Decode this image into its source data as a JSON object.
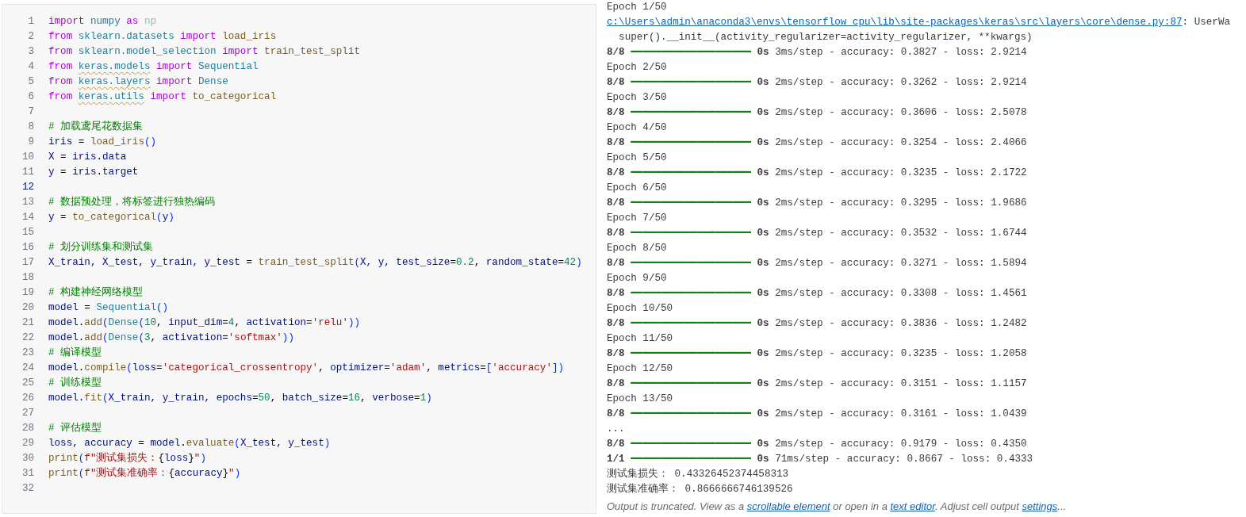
{
  "code_cell": {
    "lines": [
      {
        "n": "1",
        "active": false,
        "tokens": [
          {
            "kind": "kw",
            "text": "import"
          },
          {
            "kind": "mod",
            "text": " numpy"
          },
          {
            "kind": "kw",
            "text": " as"
          },
          {
            "kind": "dim",
            "text": " np"
          }
        ]
      },
      {
        "n": "2",
        "active": false,
        "tokens": [
          {
            "kind": "kw",
            "text": "from"
          },
          {
            "kind": "mod",
            "text": " sklearn.datasets"
          },
          {
            "kind": "kw",
            "text": " import"
          },
          {
            "kind": "fn",
            "text": " load_iris"
          }
        ]
      },
      {
        "n": "3",
        "active": false,
        "tokens": [
          {
            "kind": "kw",
            "text": "from"
          },
          {
            "kind": "mod",
            "text": " sklearn.model_selection"
          },
          {
            "kind": "kw",
            "text": " import"
          },
          {
            "kind": "fn",
            "text": " train_test_split"
          }
        ]
      },
      {
        "n": "4",
        "active": false,
        "tokens": [
          {
            "kind": "kw",
            "text": "from "
          },
          {
            "kind": "warn",
            "text": "keras.models"
          },
          {
            "kind": "kw",
            "text": " import"
          },
          {
            "kind": "mod",
            "text": " Sequential"
          }
        ]
      },
      {
        "n": "5",
        "active": false,
        "tokens": [
          {
            "kind": "kw",
            "text": "from "
          },
          {
            "kind": "warn",
            "text": "keras.layers"
          },
          {
            "kind": "kw",
            "text": " import"
          },
          {
            "kind": "mod",
            "text": " Dense"
          }
        ]
      },
      {
        "n": "6",
        "active": false,
        "tokens": [
          {
            "kind": "kw",
            "text": "from "
          },
          {
            "kind": "warn",
            "text": "keras.utils"
          },
          {
            "kind": "kw",
            "text": " import"
          },
          {
            "kind": "fn",
            "text": " to_categorical"
          }
        ]
      },
      {
        "n": "7",
        "active": false
      },
      {
        "n": "8",
        "active": false,
        "tokens": [
          {
            "kind": "com",
            "text": "# 加载鸢尾花数据集"
          }
        ]
      },
      {
        "n": "9",
        "active": false,
        "tokens": [
          {
            "kind": "var",
            "text": "iris"
          },
          {
            "kind": "p",
            "text": " = "
          },
          {
            "kind": "fn",
            "text": "load_iris"
          },
          {
            "kind": "br",
            "text": "()"
          }
        ]
      },
      {
        "n": "10",
        "active": false,
        "tokens": [
          {
            "kind": "var",
            "text": "X"
          },
          {
            "kind": "p",
            "text": " = "
          },
          {
            "kind": "var",
            "text": "iris"
          },
          {
            "kind": "p",
            "text": "."
          },
          {
            "kind": "var",
            "text": "data"
          }
        ]
      },
      {
        "n": "11",
        "active": false,
        "tokens": [
          {
            "kind": "var",
            "text": "y"
          },
          {
            "kind": "p",
            "text": " = "
          },
          {
            "kind": "var",
            "text": "iris"
          },
          {
            "kind": "p",
            "text": "."
          },
          {
            "kind": "var",
            "text": "target"
          }
        ]
      },
      {
        "n": "12",
        "active": true
      },
      {
        "n": "13",
        "active": false,
        "tokens": [
          {
            "kind": "com",
            "text": "# 数据预处理，将标签进行独热编码"
          }
        ]
      },
      {
        "n": "14",
        "active": false,
        "tokens": [
          {
            "kind": "var",
            "text": "y"
          },
          {
            "kind": "p",
            "text": " = "
          },
          {
            "kind": "fn",
            "text": "to_categorical"
          },
          {
            "kind": "br",
            "text": "("
          },
          {
            "kind": "var",
            "text": "y"
          },
          {
            "kind": "br",
            "text": ")"
          }
        ]
      },
      {
        "n": "15",
        "active": false
      },
      {
        "n": "16",
        "active": false,
        "tokens": [
          {
            "kind": "com",
            "text": "# 划分训练集和测试集"
          }
        ]
      },
      {
        "n": "17",
        "active": false,
        "tokens": [
          {
            "kind": "var",
            "text": "X_train, X_test, y_train, y_test"
          },
          {
            "kind": "p",
            "text": " = "
          },
          {
            "kind": "fn",
            "text": "train_test_split"
          },
          {
            "kind": "br",
            "text": "("
          },
          {
            "kind": "var",
            "text": "X, y, test_size"
          },
          {
            "kind": "p",
            "text": "="
          },
          {
            "kind": "num",
            "text": "0.2"
          },
          {
            "kind": "p",
            "text": ", "
          },
          {
            "kind": "var",
            "text": "random_state"
          },
          {
            "kind": "p",
            "text": "="
          },
          {
            "kind": "num",
            "text": "42"
          },
          {
            "kind": "br",
            "text": ")"
          }
        ]
      },
      {
        "n": "18",
        "active": false
      },
      {
        "n": "19",
        "active": false,
        "tokens": [
          {
            "kind": "com",
            "text": "# 构建神经网络模型"
          }
        ]
      },
      {
        "n": "20",
        "active": false,
        "tokens": [
          {
            "kind": "var",
            "text": "model"
          },
          {
            "kind": "p",
            "text": " = "
          },
          {
            "kind": "mod",
            "text": "Sequential"
          },
          {
            "kind": "br",
            "text": "()"
          }
        ]
      },
      {
        "n": "21",
        "active": false,
        "tokens": [
          {
            "kind": "var",
            "text": "model"
          },
          {
            "kind": "p",
            "text": "."
          },
          {
            "kind": "fn",
            "text": "add"
          },
          {
            "kind": "br",
            "text": "("
          },
          {
            "kind": "mod",
            "text": "Dense"
          },
          {
            "kind": "br",
            "text": "("
          },
          {
            "kind": "num",
            "text": "10"
          },
          {
            "kind": "p",
            "text": ", "
          },
          {
            "kind": "var",
            "text": "input_dim"
          },
          {
            "kind": "p",
            "text": "="
          },
          {
            "kind": "num",
            "text": "4"
          },
          {
            "kind": "p",
            "text": ", "
          },
          {
            "kind": "var",
            "text": "activation"
          },
          {
            "kind": "p",
            "text": "="
          },
          {
            "kind": "str",
            "text": "'relu'"
          },
          {
            "kind": "br",
            "text": "))"
          }
        ]
      },
      {
        "n": "22",
        "active": false,
        "tokens": [
          {
            "kind": "var",
            "text": "model"
          },
          {
            "kind": "p",
            "text": "."
          },
          {
            "kind": "fn",
            "text": "add"
          },
          {
            "kind": "br",
            "text": "("
          },
          {
            "kind": "mod",
            "text": "Dense"
          },
          {
            "kind": "br",
            "text": "("
          },
          {
            "kind": "num",
            "text": "3"
          },
          {
            "kind": "p",
            "text": ", "
          },
          {
            "kind": "var",
            "text": "activation"
          },
          {
            "kind": "p",
            "text": "="
          },
          {
            "kind": "str",
            "text": "'softmax'"
          },
          {
            "kind": "br",
            "text": "))"
          }
        ]
      },
      {
        "n": "23",
        "active": false,
        "tokens": [
          {
            "kind": "com",
            "text": "# 编译模型"
          }
        ]
      },
      {
        "n": "24",
        "active": false,
        "tokens": [
          {
            "kind": "var",
            "text": "model"
          },
          {
            "kind": "p",
            "text": "."
          },
          {
            "kind": "fn",
            "text": "compile"
          },
          {
            "kind": "br",
            "text": "("
          },
          {
            "kind": "var",
            "text": "loss"
          },
          {
            "kind": "p",
            "text": "="
          },
          {
            "kind": "str",
            "text": "'categorical_crossentropy'"
          },
          {
            "kind": "p",
            "text": ", "
          },
          {
            "kind": "var",
            "text": "optimizer"
          },
          {
            "kind": "p",
            "text": "="
          },
          {
            "kind": "str",
            "text": "'adam'"
          },
          {
            "kind": "p",
            "text": ", "
          },
          {
            "kind": "var",
            "text": "metrics"
          },
          {
            "kind": "p",
            "text": "="
          },
          {
            "kind": "br",
            "text": "["
          },
          {
            "kind": "str",
            "text": "'accuracy'"
          },
          {
            "kind": "br",
            "text": "])"
          }
        ]
      },
      {
        "n": "25",
        "active": false,
        "tokens": [
          {
            "kind": "com",
            "text": "# 训练模型"
          }
        ]
      },
      {
        "n": "26",
        "active": false,
        "tokens": [
          {
            "kind": "var",
            "text": "model"
          },
          {
            "kind": "p",
            "text": "."
          },
          {
            "kind": "fn",
            "text": "fit"
          },
          {
            "kind": "br",
            "text": "("
          },
          {
            "kind": "var",
            "text": "X_train, y_train, epochs"
          },
          {
            "kind": "p",
            "text": "="
          },
          {
            "kind": "num",
            "text": "50"
          },
          {
            "kind": "p",
            "text": ", "
          },
          {
            "kind": "var",
            "text": "batch_size"
          },
          {
            "kind": "p",
            "text": "="
          },
          {
            "kind": "num",
            "text": "16"
          },
          {
            "kind": "p",
            "text": ", "
          },
          {
            "kind": "var",
            "text": "verbose"
          },
          {
            "kind": "p",
            "text": "="
          },
          {
            "kind": "num",
            "text": "1"
          },
          {
            "kind": "br",
            "text": ")"
          }
        ]
      },
      {
        "n": "27",
        "active": false
      },
      {
        "n": "28",
        "active": false,
        "tokens": [
          {
            "kind": "com",
            "text": "# 评估模型"
          }
        ]
      },
      {
        "n": "29",
        "active": false,
        "tokens": [
          {
            "kind": "var",
            "text": "loss, accuracy"
          },
          {
            "kind": "p",
            "text": " = "
          },
          {
            "kind": "var",
            "text": "model"
          },
          {
            "kind": "p",
            "text": "."
          },
          {
            "kind": "fn",
            "text": "evaluate"
          },
          {
            "kind": "br",
            "text": "("
          },
          {
            "kind": "var",
            "text": "X_test, y_test"
          },
          {
            "kind": "br",
            "text": ")"
          }
        ]
      },
      {
        "n": "30",
        "active": false,
        "tokens": [
          {
            "kind": "fn",
            "text": "print"
          },
          {
            "kind": "br",
            "text": "("
          },
          {
            "kind": "str",
            "text": "f\"测试集损失："
          },
          {
            "kind": "p",
            "text": "{"
          },
          {
            "kind": "var",
            "text": "loss"
          },
          {
            "kind": "p",
            "text": "}"
          },
          {
            "kind": "str",
            "text": "\""
          },
          {
            "kind": "br",
            "text": ")"
          }
        ]
      },
      {
        "n": "31",
        "active": false,
        "tokens": [
          {
            "kind": "fn",
            "text": "print"
          },
          {
            "kind": "br",
            "text": "("
          },
          {
            "kind": "str",
            "text": "f\"测试集准确率："
          },
          {
            "kind": "p",
            "text": "{"
          },
          {
            "kind": "var",
            "text": "accuracy"
          },
          {
            "kind": "p",
            "text": "}"
          },
          {
            "kind": "str",
            "text": "\""
          },
          {
            "kind": "br",
            "text": ")"
          }
        ]
      },
      {
        "n": "32",
        "active": false
      }
    ]
  },
  "output": {
    "lines": [
      {
        "kind": "text",
        "text": "Epoch 1/50"
      },
      {
        "kind": "link",
        "link": "c:\\Users\\admin\\anaconda3\\envs\\tensorflow_cpu\\lib\\site-packages\\keras\\src\\layers\\core\\dense.py:87",
        "text": ": UserWa"
      },
      {
        "kind": "text",
        "text": "  super().__init__(activity_regularizer=activity_regularizer, **kwargs)"
      },
      {
        "kind": "progress",
        "count": "8/8",
        "bar": "━━━━━━━━━━━━━━━━━━━━",
        "time": "0s",
        "text": "3ms/step - accuracy: 0.3827 - loss: 2.9214"
      },
      {
        "kind": "text",
        "text": "Epoch 2/50"
      },
      {
        "kind": "progress",
        "count": "8/8",
        "bar": "━━━━━━━━━━━━━━━━━━━━",
        "time": "0s",
        "text": "2ms/step - accuracy: 0.3262 - loss: 2.9214"
      },
      {
        "kind": "text",
        "text": "Epoch 3/50"
      },
      {
        "kind": "progress",
        "count": "8/8",
        "bar": "━━━━━━━━━━━━━━━━━━━━",
        "time": "0s",
        "text": "2ms/step - accuracy: 0.3606 - loss: 2.5078"
      },
      {
        "kind": "text",
        "text": "Epoch 4/50"
      },
      {
        "kind": "progress",
        "count": "8/8",
        "bar": "━━━━━━━━━━━━━━━━━━━━",
        "time": "0s",
        "text": "2ms/step - accuracy: 0.3254 - loss: 2.4066"
      },
      {
        "kind": "text",
        "text": "Epoch 5/50"
      },
      {
        "kind": "progress",
        "count": "8/8",
        "bar": "━━━━━━━━━━━━━━━━━━━━",
        "time": "0s",
        "text": "2ms/step - accuracy: 0.3235 - loss: 2.1722"
      },
      {
        "kind": "text",
        "text": "Epoch 6/50"
      },
      {
        "kind": "progress",
        "count": "8/8",
        "bar": "━━━━━━━━━━━━━━━━━━━━",
        "time": "0s",
        "text": "2ms/step - accuracy: 0.3295 - loss: 1.9686"
      },
      {
        "kind": "text",
        "text": "Epoch 7/50"
      },
      {
        "kind": "progress",
        "count": "8/8",
        "bar": "━━━━━━━━━━━━━━━━━━━━",
        "time": "0s",
        "text": "2ms/step - accuracy: 0.3532 - loss: 1.6744"
      },
      {
        "kind": "text",
        "text": "Epoch 8/50"
      },
      {
        "kind": "progress",
        "count": "8/8",
        "bar": "━━━━━━━━━━━━━━━━━━━━",
        "time": "0s",
        "text": "2ms/step - accuracy: 0.3271 - loss: 1.5894"
      },
      {
        "kind": "text",
        "text": "Epoch 9/50"
      },
      {
        "kind": "progress",
        "count": "8/8",
        "bar": "━━━━━━━━━━━━━━━━━━━━",
        "time": "0s",
        "text": "2ms/step - accuracy: 0.3308 - loss: 1.4561"
      },
      {
        "kind": "text",
        "text": "Epoch 10/50"
      },
      {
        "kind": "progress",
        "count": "8/8",
        "bar": "━━━━━━━━━━━━━━━━━━━━",
        "time": "0s",
        "text": "2ms/step - accuracy: 0.3836 - loss: 1.2482"
      },
      {
        "kind": "text",
        "text": "Epoch 11/50"
      },
      {
        "kind": "progress",
        "count": "8/8",
        "bar": "━━━━━━━━━━━━━━━━━━━━",
        "time": "0s",
        "text": "2ms/step - accuracy: 0.3235 - loss: 1.2058"
      },
      {
        "kind": "text",
        "text": "Epoch 12/50"
      },
      {
        "kind": "progress",
        "count": "8/8",
        "bar": "━━━━━━━━━━━━━━━━━━━━",
        "time": "0s",
        "text": "2ms/step - accuracy: 0.3151 - loss: 1.1157"
      },
      {
        "kind": "text",
        "text": "Epoch 13/50"
      },
      {
        "kind": "progress",
        "count": "8/8",
        "bar": "━━━━━━━━━━━━━━━━━━━━",
        "time": "0s",
        "text": "2ms/step - accuracy: 0.3161 - loss: 1.0439"
      },
      {
        "kind": "text",
        "text": "..."
      },
      {
        "kind": "progress",
        "count": "8/8",
        "bar": "━━━━━━━━━━━━━━━━━━━━",
        "time": "0s",
        "text": "2ms/step - accuracy: 0.9179 - loss: 0.4350"
      },
      {
        "kind": "progress",
        "count": "1/1",
        "bar": "━━━━━━━━━━━━━━━━━━━━",
        "time": "0s",
        "text": "71ms/step - accuracy: 0.8667 - loss: 0.4333"
      },
      {
        "kind": "text",
        "text": "测试集损失： 0.43326452374458313"
      },
      {
        "kind": "text",
        "text": "测试集准确率： 0.8666666746139526"
      }
    ],
    "notice": [
      {
        "kind": "text",
        "text": "Output is truncated. View as a "
      },
      {
        "kind": "link",
        "text": "scrollable element"
      },
      {
        "kind": "text",
        "text": " or open in a "
      },
      {
        "kind": "link",
        "text": "text editor"
      },
      {
        "kind": "text",
        "text": ". Adjust cell output "
      },
      {
        "kind": "link",
        "text": "settings"
      },
      {
        "kind": "text",
        "text": "..."
      }
    ]
  }
}
